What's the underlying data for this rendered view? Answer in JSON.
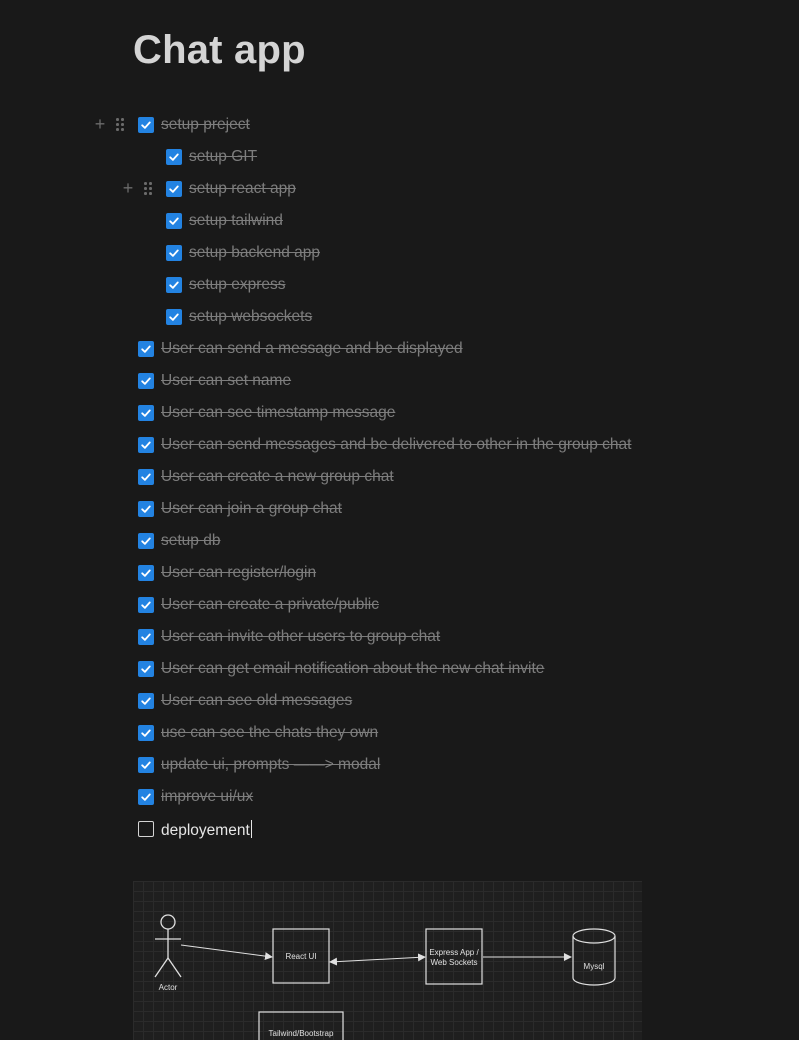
{
  "page": {
    "title": "Chat app"
  },
  "todos": [
    {
      "text": "setup preject",
      "checked": true,
      "nested": false
    },
    {
      "text": "setup GIT",
      "checked": true,
      "nested": true
    },
    {
      "text": "setup react app",
      "checked": true,
      "nested": true
    },
    {
      "text": "setup tailwind",
      "checked": true,
      "nested": true
    },
    {
      "text": "setup backend app",
      "checked": true,
      "nested": true
    },
    {
      "text": "setup express",
      "checked": true,
      "nested": true
    },
    {
      "text": "setup websockets",
      "checked": true,
      "nested": true
    },
    {
      "text": "User can send a message and be displayed",
      "checked": true,
      "nested": false
    },
    {
      "text": "User can set name",
      "checked": true,
      "nested": false
    },
    {
      "text": "User can see timestamp message",
      "checked": true,
      "nested": false
    },
    {
      "text": "User can send messages and be delivered to other in the group chat",
      "checked": true,
      "nested": false
    },
    {
      "text": "User can create a new group chat",
      "checked": true,
      "nested": false
    },
    {
      "text": "User can join a group chat",
      "checked": true,
      "nested": false
    },
    {
      "text": "setup db",
      "checked": true,
      "nested": false
    },
    {
      "text": "User can register/login",
      "checked": true,
      "nested": false
    },
    {
      "text": "User can create a private/public",
      "checked": true,
      "nested": false
    },
    {
      "text": "User can invite other users to group chat",
      "checked": true,
      "nested": false
    },
    {
      "text": "User can get email notification about the new chat invite",
      "checked": true,
      "nested": false
    },
    {
      "text": "User can see old messages",
      "checked": true,
      "nested": false
    },
    {
      "text": "use can see the chats they own",
      "checked": true,
      "nested": false
    },
    {
      "text": "update ui, prompts ——> modal",
      "checked": true,
      "nested": false
    },
    {
      "text": "improve ui/ux",
      "checked": true,
      "nested": false
    },
    {
      "text": "deployement",
      "checked": false,
      "nested": false
    }
  ],
  "diagram": {
    "actor_label": "Actor",
    "react_label": "React UI",
    "express_label_line1": "Express App /",
    "express_label_line2": "Web Sockets",
    "db_label": "Mysql",
    "css_label": "Tailwind/Bootstrap"
  },
  "colors": {
    "background": "#191919",
    "checkbox_checked": "#2383e2",
    "done_text": "#7d7d7d",
    "title": "#d4d4d4"
  },
  "icons": {
    "checked_box": "checkmark-icon",
    "add": "plus-icon",
    "drag": "drag-handle-icon"
  }
}
